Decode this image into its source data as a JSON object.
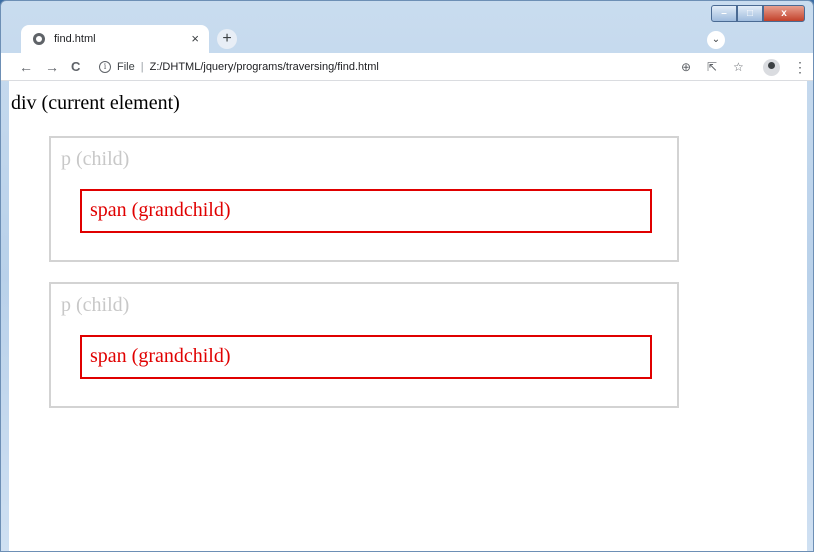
{
  "browser": {
    "tab_title": "find.html",
    "tab_close": "×",
    "new_tab": "+",
    "tab_search": "⌄",
    "controls": {
      "minimize": "–",
      "maximize": "□",
      "close": "x"
    },
    "nav": {
      "back": "←",
      "forward": "→",
      "reload": "C"
    },
    "address": {
      "info": "i",
      "scheme": "File",
      "separator": "|",
      "url": "Z:/DHTML/jquery/programs/traversing/find.html"
    },
    "toolbar_icons": {
      "zoom": "⊕",
      "share": "⇱",
      "bookmark": "☆",
      "menu": "⋮"
    }
  },
  "page": {
    "div_label": "div (current element)",
    "children": [
      {
        "p_label": "p (child)",
        "span_label": "span (grandchild)"
      },
      {
        "p_label": "p (child)",
        "span_label": "span (grandchild)"
      }
    ],
    "colors": {
      "highlight": "#e00000",
      "muted": "#d3d3d3"
    }
  }
}
